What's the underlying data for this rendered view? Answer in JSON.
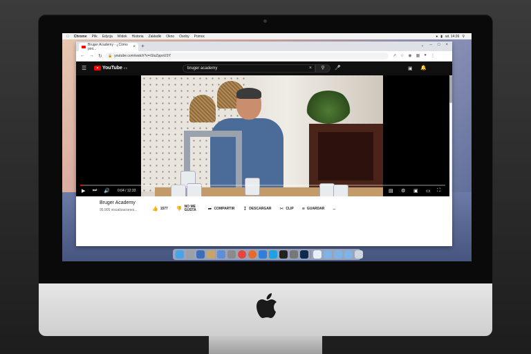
{
  "menubar": {
    "app": "Chrome",
    "items": [
      "Plik",
      "Edycja",
      "Widok",
      "Historia",
      "Zakładki",
      "Okno",
      "Osoby",
      "Pomoc"
    ],
    "clock": "wt. 14:26"
  },
  "browser": {
    "tab_title": "Bruger Academy - ¿Cómo pint...",
    "url": "youtube.com/watch?v=rSluZppoUSY"
  },
  "youtube": {
    "logo_text": "YouTube",
    "logo_sup": "ES",
    "search_value": "bruger academy",
    "player": {
      "time": "0:04 / 12:33",
      "progress": 0.005
    },
    "channel_name": "Bruger Academy",
    "views": "95.905 visualizaciones...",
    "actions": {
      "likes": "1577",
      "dislike": "NO ME GUSTA",
      "share": "COMPARTIR",
      "download": "DESCARGAR",
      "clip": "CLIP",
      "save": "GUARDAR",
      "more": "..."
    }
  },
  "colors": {
    "youtube_red": "#ff0000",
    "player_bg": "#000000",
    "header_bg": "#0f0f0f"
  }
}
